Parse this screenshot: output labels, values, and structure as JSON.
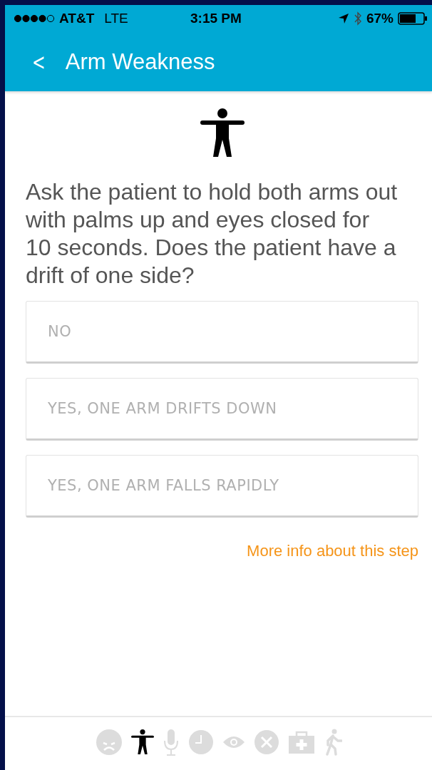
{
  "status_bar": {
    "carrier": "AT&T",
    "network": "LTE",
    "time": "3:15 PM",
    "battery_text": "67%"
  },
  "header": {
    "back": "<",
    "title": "Arm Weakness"
  },
  "question": "Ask the patient to hold both arms out with palms up and eyes closed for 10 seconds. Does the patient have a drift of one side?",
  "options": [
    {
      "label": "NO",
      "selected": false
    },
    {
      "label": "YES, ONE ARM DRIFTS DOWN",
      "selected": false
    },
    {
      "label": "YES, ONE ARM FALLS RAPIDLY",
      "selected": false
    }
  ],
  "info_link": "More info about this step",
  "steps": [
    {
      "kind": "face",
      "selected": false
    },
    {
      "kind": "body",
      "selected": true
    },
    {
      "kind": "mic",
      "selected": false
    },
    {
      "kind": "clock",
      "selected": false
    },
    {
      "kind": "eye",
      "selected": false
    },
    {
      "kind": "cross",
      "selected": false
    },
    {
      "kind": "medkit",
      "selected": false
    },
    {
      "kind": "walker",
      "selected": false
    }
  ]
}
